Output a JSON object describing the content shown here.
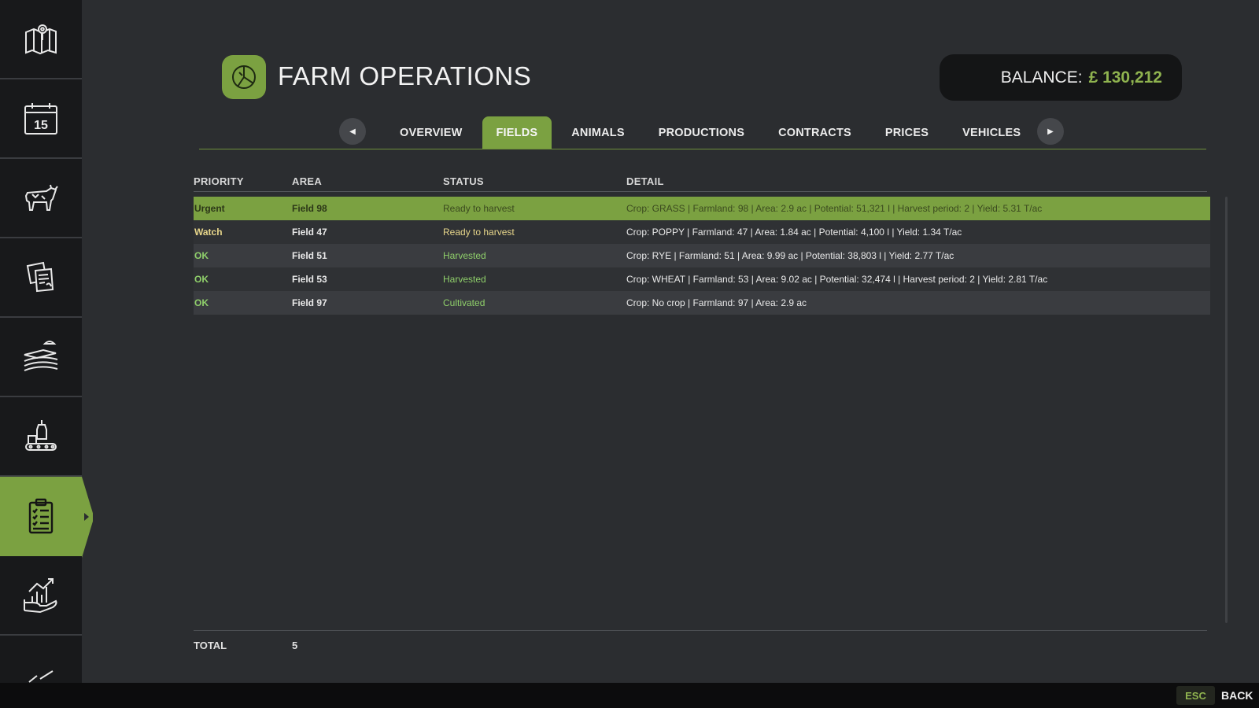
{
  "colors": {
    "accent": "#7ba141",
    "accent_text": "#8fb34f",
    "background": "#2b2d30",
    "sidebar": "#18191b",
    "status_yellow": "#e6d58a",
    "status_green": "#8fcf6a"
  },
  "sidebar": {
    "items": [
      {
        "icon": "map-icon"
      },
      {
        "icon": "calendar-icon",
        "text": "15"
      },
      {
        "icon": "cow-icon"
      },
      {
        "icon": "documents-icon"
      },
      {
        "icon": "fields-icon"
      },
      {
        "icon": "production-icon"
      },
      {
        "icon": "clipboard-icon",
        "active": true
      },
      {
        "icon": "finance-icon"
      },
      {
        "icon": "more-icon"
      }
    ]
  },
  "header": {
    "title": "FARM OPERATIONS",
    "icon": "pie-chart-icon"
  },
  "balance": {
    "label": "BALANCE:",
    "value": "£ 130,212"
  },
  "tabs": [
    {
      "label": "OVERVIEW"
    },
    {
      "label": "FIELDS",
      "active": true
    },
    {
      "label": "ANIMALS"
    },
    {
      "label": "PRODUCTIONS"
    },
    {
      "label": "CONTRACTS"
    },
    {
      "label": "PRICES"
    },
    {
      "label": "VEHICLES"
    }
  ],
  "table": {
    "columns": [
      "PRIORITY",
      "AREA",
      "STATUS",
      "DETAIL"
    ],
    "rows": [
      {
        "priority": "Urgent",
        "area": "Field 98",
        "status": "Ready to harvest",
        "detail": "Crop: GRASS | Farmland: 98 | Area: 2.9 ac | Potential: 51,321 l | Harvest period: 2 | Yield: 5.31 T/ac",
        "selected": true
      },
      {
        "priority": "Watch",
        "area": "Field 47",
        "status": "Ready to harvest",
        "detail": "Crop: POPPY | Farmland: 47 | Area: 1.84 ac | Potential: 4,100 l | Yield: 1.34 T/ac"
      },
      {
        "priority": "OK",
        "area": "Field 51",
        "status": "Harvested",
        "detail": "Crop: RYE | Farmland: 51 | Area: 9.99 ac | Potential: 38,803 l | Yield: 2.77 T/ac"
      },
      {
        "priority": "OK",
        "area": "Field 53",
        "status": "Harvested",
        "detail": "Crop: WHEAT | Farmland: 53 | Area: 9.02 ac | Potential: 32,474 l | Harvest period: 2 | Yield: 2.81 T/ac"
      },
      {
        "priority": "OK",
        "area": "Field 97",
        "status": "Cultivated",
        "detail": "Crop: No crop | Farmland: 97 | Area: 2.9 ac"
      }
    ],
    "total_label": "TOTAL",
    "total_value": "5"
  },
  "footer": {
    "esc_key": "ESC",
    "back_label": "BACK"
  }
}
